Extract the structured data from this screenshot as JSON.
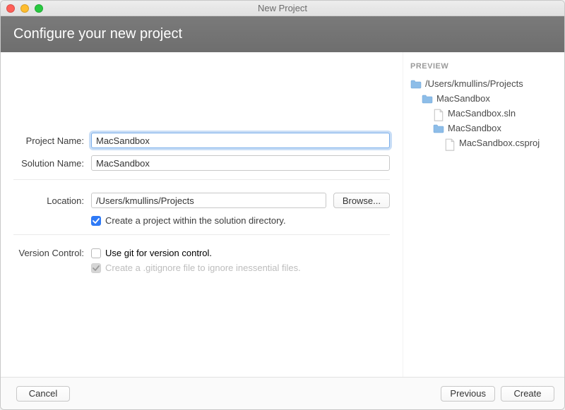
{
  "window_title": "New Project",
  "header_title": "Configure your new project",
  "labels": {
    "project_name": "Project Name:",
    "solution_name": "Solution Name:",
    "location": "Location:",
    "version_control": "Version Control:"
  },
  "fields": {
    "project_name": "MacSandbox",
    "solution_name": "MacSandbox",
    "location": "/Users/kmullins/Projects"
  },
  "buttons": {
    "browse": "Browse...",
    "cancel": "Cancel",
    "previous": "Previous",
    "create": "Create"
  },
  "checks": {
    "create_in_solution": "Create a project within the solution directory.",
    "use_git": "Use git for version control.",
    "gitignore": "Create a .gitignore file to ignore inessential files."
  },
  "preview": {
    "title": "PREVIEW",
    "root": "/Users/kmullins/Projects",
    "sln_folder": "MacSandbox",
    "sln_file": "MacSandbox.sln",
    "proj_folder": "MacSandbox",
    "proj_file": "MacSandbox.csproj"
  }
}
